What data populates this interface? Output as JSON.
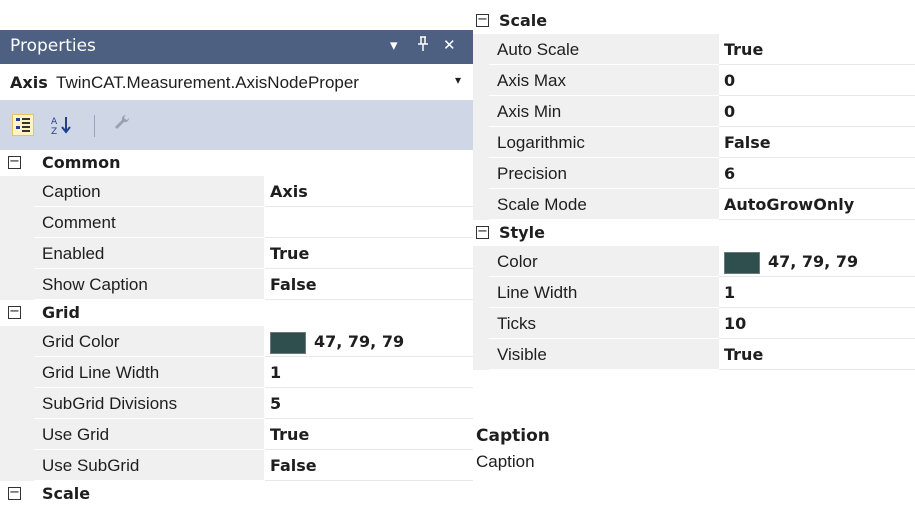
{
  "panel": {
    "title": "Properties",
    "dropdown_glyph": "▾",
    "pin_glyph": "ꟷ",
    "close_glyph": "✕"
  },
  "object": {
    "name": "Axis",
    "type": "TwinCAT.Measurement.AxisNodeProper",
    "dropdown_glyph": "▾"
  },
  "toolbar": {
    "categorized_icon": "categorized-view-icon",
    "alphabetical_icon": "alphabetical-sort-icon",
    "property_pages_icon": "wrench-icon"
  },
  "left_grid": {
    "common": {
      "label": "Common",
      "caption": {
        "name": "Caption",
        "value": "Axis"
      },
      "comment": {
        "name": "Comment",
        "value": ""
      },
      "enabled": {
        "name": "Enabled",
        "value": "True"
      },
      "show_caption": {
        "name": "Show Caption",
        "value": "False"
      }
    },
    "grid": {
      "label": "Grid",
      "grid_color": {
        "name": "Grid Color",
        "value": "47, 79, 79",
        "color": "#2f4f4f"
      },
      "grid_line_width": {
        "name": "Grid Line Width",
        "value": "1"
      },
      "subgrid_divisions": {
        "name": "SubGrid Divisions",
        "value": "5"
      },
      "use_grid": {
        "name": "Use Grid",
        "value": "True"
      },
      "use_subgrid": {
        "name": "Use SubGrid",
        "value": "False"
      }
    },
    "scale": {
      "label": "Scale"
    }
  },
  "right_grid": {
    "scale": {
      "label": "Scale",
      "auto_scale": {
        "name": "Auto Scale",
        "value": "True"
      },
      "axis_max": {
        "name": "Axis Max",
        "value": "0"
      },
      "axis_min": {
        "name": "Axis Min",
        "value": "0"
      },
      "logarithmic": {
        "name": "Logarithmic",
        "value": "False"
      },
      "precision": {
        "name": "Precision",
        "value": "6"
      },
      "scale_mode": {
        "name": "Scale Mode",
        "value": "AutoGrowOnly"
      }
    },
    "style": {
      "label": "Style",
      "color": {
        "name": "Color",
        "value": "47, 79, 79",
        "color": "#2f4f4f"
      },
      "line_width": {
        "name": "Line Width",
        "value": "1"
      },
      "ticks": {
        "name": "Ticks",
        "value": "10"
      },
      "visible": {
        "name": "Visible",
        "value": "True"
      }
    }
  },
  "description": {
    "title": "Caption",
    "text": "Caption"
  },
  "colors": {
    "titlebar": "#4d6082",
    "toolbar": "#cfd6e5",
    "swatch": "#2f4f4f"
  }
}
